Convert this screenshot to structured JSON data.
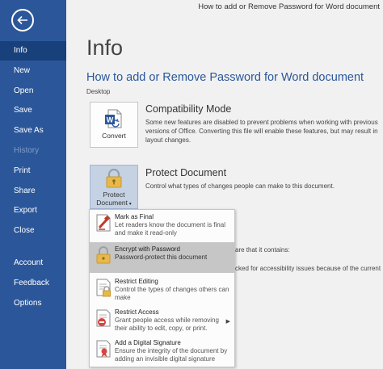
{
  "window": {
    "doc_title": "How to add or Remove Password for Word document"
  },
  "sidebar": {
    "items": [
      {
        "label": "Info"
      },
      {
        "label": "New"
      },
      {
        "label": "Open"
      },
      {
        "label": "Save"
      },
      {
        "label": "Save As"
      },
      {
        "label": "History"
      },
      {
        "label": "Print"
      },
      {
        "label": "Share"
      },
      {
        "label": "Export"
      },
      {
        "label": "Close"
      },
      {
        "label": "Account"
      },
      {
        "label": "Feedback"
      },
      {
        "label": "Options"
      }
    ]
  },
  "main": {
    "heading": "Info",
    "doc_name": "How to add or Remove Password for Word document",
    "doc_path": "Desktop",
    "compat": {
      "button_label": "Convert",
      "title": "Compatibility Mode",
      "desc": "Some new features are disabled to prevent problems when working with previous versions of Office. Converting this file will enable these features, but may result in layout changes."
    },
    "protect": {
      "button_line1": "Protect",
      "button_line2": "Document",
      "title": "Protect Document",
      "desc": "Control what types of changes people can make to this document."
    },
    "partial": {
      "line1": "are that it contains:",
      "line2": "cked for accessibility issues because of the current"
    }
  },
  "dropdown": {
    "items": [
      {
        "title": "Mark as Final",
        "desc": "Let readers know the document is final and make it read-only",
        "icon": "mark-final-icon"
      },
      {
        "title": "Encrypt with Password",
        "desc": "Password-protect this document",
        "icon": "lock-key-icon"
      },
      {
        "title": "Restrict Editing",
        "desc": "Control the types of changes others can make",
        "icon": "restrict-editing-icon"
      },
      {
        "title": "Restrict Access",
        "desc": "Grant people access while removing their ability to edit, copy, or print.",
        "icon": "restrict-access-icon"
      },
      {
        "title": "Add a Digital Signature",
        "desc": "Ensure the integrity of the document by adding an invisible digital signature",
        "icon": "digital-signature-icon"
      }
    ]
  },
  "colors": {
    "accent": "#2b579a",
    "sidebar_active": "#18407a",
    "highlight": "#c6c6c6"
  }
}
